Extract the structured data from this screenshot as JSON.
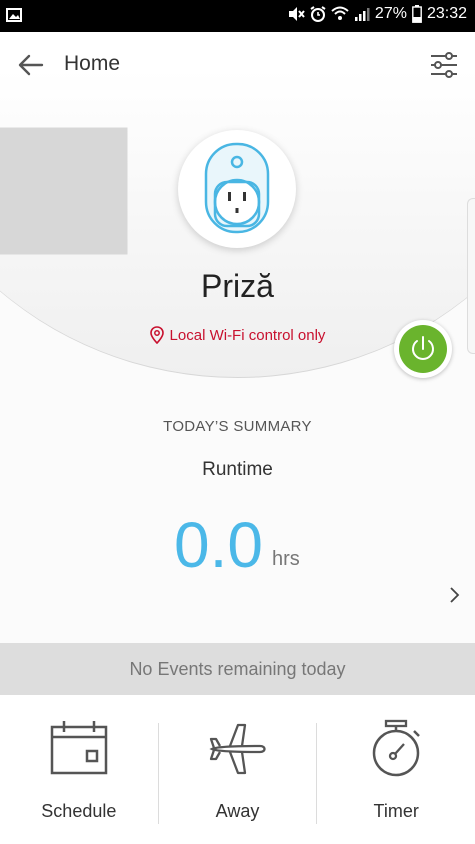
{
  "status_bar": {
    "battery_percent": "27%",
    "time": "23:32",
    "icons": [
      "image-icon",
      "mute-icon",
      "alarm-icon",
      "wifi-icon",
      "signal-icon",
      "battery-icon"
    ]
  },
  "header": {
    "title": "Home",
    "back_icon": "arrow-left-icon",
    "settings_icon": "sliders-icon"
  },
  "device": {
    "name": "Priză",
    "icon": "smart-plug-icon",
    "wifi_note": "Local Wi-Fi control only",
    "power_state": "on"
  },
  "summary": {
    "title": "TODAY’S SUMMARY",
    "metric_label": "Runtime",
    "value": "0.0",
    "unit": "hrs"
  },
  "events": {
    "text": "No Events remaining today"
  },
  "nav": {
    "items": [
      {
        "label": "Schedule",
        "icon": "calendar-icon"
      },
      {
        "label": "Away",
        "icon": "airplane-icon"
      },
      {
        "label": "Timer",
        "icon": "stopwatch-icon"
      }
    ]
  },
  "colors": {
    "accent_blue": "#4bb8e8",
    "power_green": "#6ab42d",
    "warning_red": "#c8102e"
  }
}
